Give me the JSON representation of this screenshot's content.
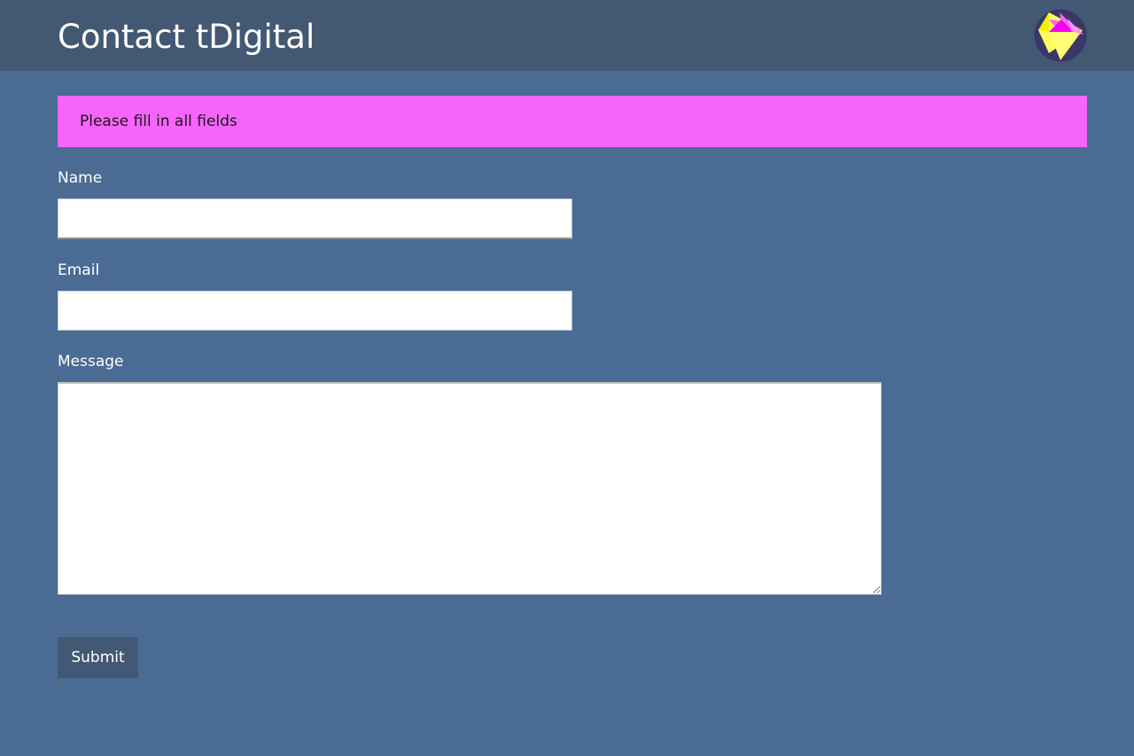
{
  "header": {
    "title": "Contact tDigital",
    "logo_icon": "tdigital-diamond-logo-icon",
    "background": "#435872"
  },
  "alert": {
    "message": "Please fill in all fields",
    "color": "#f764fb"
  },
  "form": {
    "name_label": "Name",
    "name_value": "",
    "email_label": "Email",
    "email_value": "",
    "message_label": "Message",
    "message_value": "",
    "submit_label": "Submit"
  },
  "colors": {
    "page_background": "#4a6b94",
    "button_background": "#435872"
  }
}
